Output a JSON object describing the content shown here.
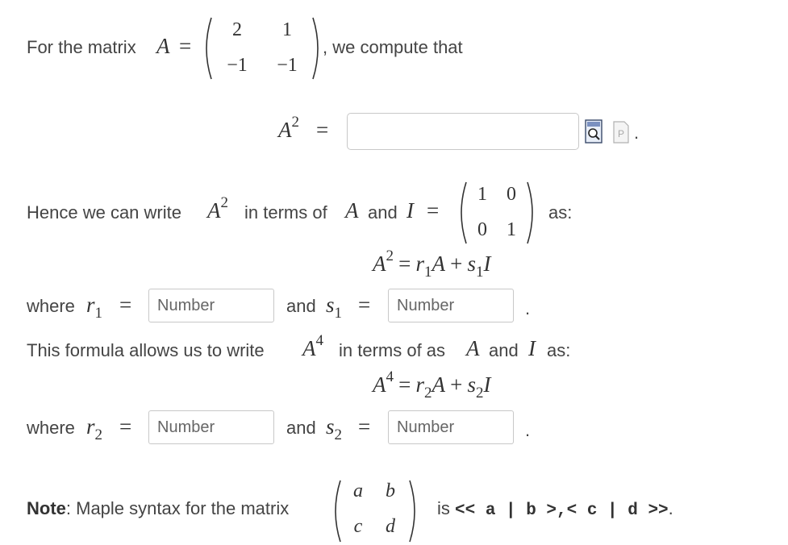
{
  "intro": {
    "prefix": "For the matrix",
    "A": "A",
    "eq": "=",
    "suffix": ", we compute that",
    "matrix_A": [
      "2",
      "1",
      "−1",
      "−1"
    ]
  },
  "a2_row": {
    "A": "A",
    "exp": "2",
    "eq": "=",
    "input_value": "",
    "preview_icon": "magnifier-preview-icon",
    "syntax_icon": "maple-syntax-icon",
    "end": "."
  },
  "hence": {
    "prefix": "Hence we can write",
    "A": "A",
    "exp": "2",
    "middle": "in terms of",
    "A2": "A",
    "and": "and",
    "I": "I",
    "eq": "=",
    "suffix": "as:",
    "identity": [
      "1",
      "0",
      "0",
      "1"
    ]
  },
  "formula1": {
    "lhs": "A",
    "lhs_exp": "2",
    "eq": "=",
    "r": "r",
    "r_sub": "1",
    "A": "A",
    "plus": "+",
    "s": "s",
    "s_sub": "1",
    "I": "I"
  },
  "row1": {
    "where": "where",
    "r": "r",
    "r_sub": "1",
    "eq": "=",
    "r_placeholder": "Number",
    "and": "and",
    "s": "s",
    "s_sub": "1",
    "eq2": "=",
    "s_placeholder": "Number",
    "end": "."
  },
  "allows": {
    "prefix": "This formula allows us to write",
    "A": "A",
    "exp": "4",
    "middle": "in terms of as",
    "A2": "A",
    "and": "and",
    "I": "I",
    "suffix": "as:"
  },
  "formula2": {
    "lhs": "A",
    "lhs_exp": "4",
    "eq": "=",
    "r": "r",
    "r_sub": "2",
    "A": "A",
    "plus": "+",
    "s": "s",
    "s_sub": "2",
    "I": "I"
  },
  "row2": {
    "where": "where",
    "r": "r",
    "r_sub": "2",
    "eq": "=",
    "r_placeholder": "Number",
    "and": "and",
    "s": "s",
    "s_sub": "2",
    "eq2": "=",
    "s_placeholder": "Number",
    "end": "."
  },
  "note": {
    "bold": "Note",
    "text": ": Maple syntax for the matrix",
    "matrix": [
      "a",
      "b",
      "c",
      "d"
    ],
    "is": "is",
    "code": "<< a | b >,< c | d >>",
    "end": "."
  }
}
